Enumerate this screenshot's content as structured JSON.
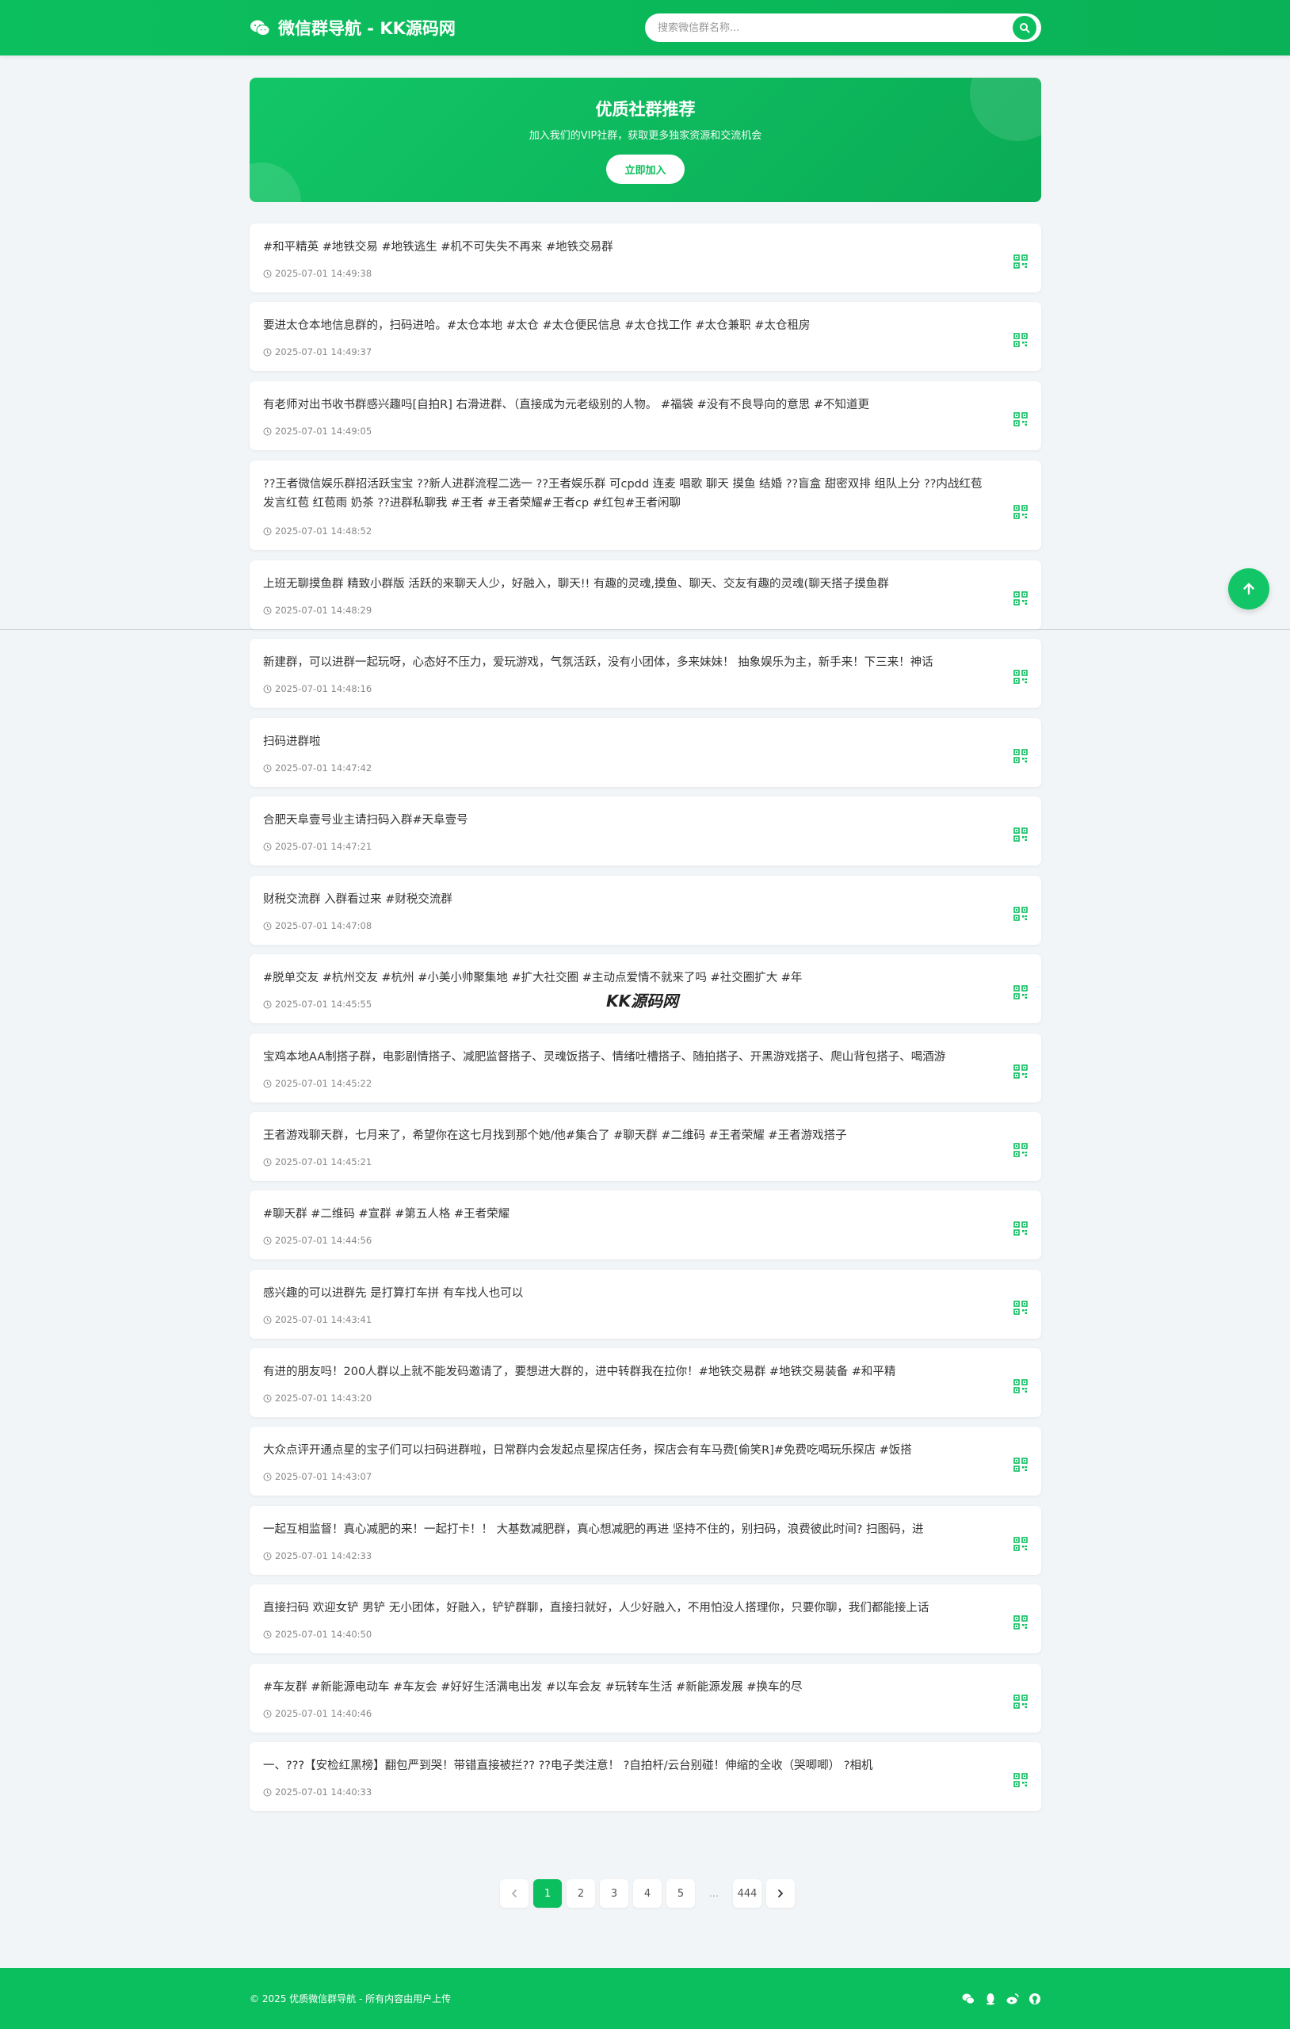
{
  "header": {
    "title": "微信群导航 - KK源码网",
    "search_placeholder": "搜索微信群名称..."
  },
  "banner": {
    "title": "优质社群推荐",
    "subtitle": "加入我们的VIP社群，获取更多独家资源和交流机会",
    "button": "立即加入"
  },
  "groups": [
    {
      "title": "#和平精英 #地铁交易 #地铁逃生 #机不可失失不再来 #地铁交易群",
      "time": "2025-07-01 14:49:38"
    },
    {
      "title": "要进太仓本地信息群的，扫码进哈。#太仓本地 #太仓 #太仓便民信息 #太仓找工作 #太仓兼职 #太仓租房",
      "time": "2025-07-01 14:49:37"
    },
    {
      "title": "有老师对出书收书群感兴趣吗[自拍R] 右滑进群、（直接成为元老级别的人物。 #福袋 #没有不良导向的意思 #不知道更",
      "time": "2025-07-01 14:49:05"
    },
    {
      "title": "??王者微信娱乐群招活跃宝宝 ??新人进群流程二选一 ??王者娱乐群 可cpdd 连麦 唱歌 聊天 摸鱼 结婚 ??盲盒 甜密双排 组队上分 ??内战红苞 发言红苞 红苞雨 奶茶 ??进群私聊我 #王者 #王者荣耀#王者cp #红包#王者闲聊",
      "time": "2025-07-01 14:48:52"
    },
    {
      "title": "上班无聊摸鱼群 精致小群版 活跃的来聊天人少，好融入，聊天!! 有趣的灵魂,摸鱼、聊天、交友有趣的灵魂(聊天搭子摸鱼群",
      "time": "2025-07-01 14:48:29"
    },
    {
      "title": "新建群，可以进群一起玩呀，心态好不压力，爱玩游戏，气氛活跃，没有小团体，多来妹妹！ 抽象娱乐为主，新手来！下三来！神话",
      "time": "2025-07-01 14:48:16"
    },
    {
      "title": "扫码进群啦",
      "time": "2025-07-01 14:47:42"
    },
    {
      "title": "合肥天阜壹号业主请扫码入群#天阜壹号",
      "time": "2025-07-01 14:47:21"
    },
    {
      "title": "财税交流群 入群看过来 #财税交流群",
      "time": "2025-07-01 14:47:08"
    },
    {
      "title": "#脱单交友 #杭州交友 #杭州 #小美小帅聚集地 #扩大社交圈 #主动点爱情不就来了吗 #社交圈扩大 #年",
      "time": "2025-07-01 14:45:55"
    },
    {
      "title": "宝鸡本地AA制搭子群，电影剧情搭子、减肥监督搭子、灵魂饭搭子、情绪吐槽搭子、随拍搭子、开黑游戏搭子、爬山背包搭子、喝酒游",
      "time": "2025-07-01 14:45:22"
    },
    {
      "title": "王者游戏聊天群，七月来了，希望你在这七月找到那个她/他#集合了 #聊天群 #二维码 #王者荣耀 #王者游戏搭子",
      "time": "2025-07-01 14:45:21"
    },
    {
      "title": "#聊天群 #二维码 #宣群 #第五人格 #王者荣耀",
      "time": "2025-07-01 14:44:56"
    },
    {
      "title": "感兴趣的可以进群先 是打算打车拼 有车找人也可以",
      "time": "2025-07-01 14:43:41"
    },
    {
      "title": "有进的朋友吗！200人群以上就不能发码邀请了，要想进大群的，进中转群我在拉你！#地铁交易群 #地铁交易装备 #和平精",
      "time": "2025-07-01 14:43:20"
    },
    {
      "title": "大众点评开通点星的宝子们可以扫码进群啦，日常群内会发起点星探店任务，探店会有车马费[偷笑R]#免费吃喝玩乐探店 #饭搭",
      "time": "2025-07-01 14:43:07"
    },
    {
      "title": "一起互相监督！真心减肥的来！一起打卡！！ 大基数减肥群，真心想减肥的再进 坚持不住的，别扫码，浪费彼此时间? 扫图码，进",
      "time": "2025-07-01 14:42:33"
    },
    {
      "title": "直接扫码 欢迎女铲 男铲 无小团体，好融入，铲铲群聊，直接扫就好，人少好融入，不用怕没人搭理你，只要你聊，我们都能接上话",
      "time": "2025-07-01 14:40:50"
    },
    {
      "title": "#车友群 #新能源电动车 #车友会 #好好生活满电出发 #以车会友 #玩转车生活 #新能源发展 #换车的尽",
      "time": "2025-07-01 14:40:46"
    },
    {
      "title": "一、???【安检红黑榜】翻包严到哭！带错直接被拦?? ??电子类注意！ ?自拍杆/云台别碰！伸缩的全收（哭唧唧） ?相机",
      "time": "2025-07-01 14:40:33"
    }
  ],
  "watermark": "KK源码网",
  "pagination": {
    "pages": [
      "1",
      "2",
      "3",
      "4",
      "5",
      "...",
      "444"
    ],
    "active": "1"
  },
  "footer": {
    "copyright": "© 2025 优质微信群导航 - 所有内容由用户上传",
    "social_icons": [
      "wechat-icon",
      "qq-icon",
      "weibo-icon",
      "github-icon"
    ]
  },
  "colors": {
    "brand_green": "#0cbf5e",
    "background": "#f2f5f7"
  }
}
